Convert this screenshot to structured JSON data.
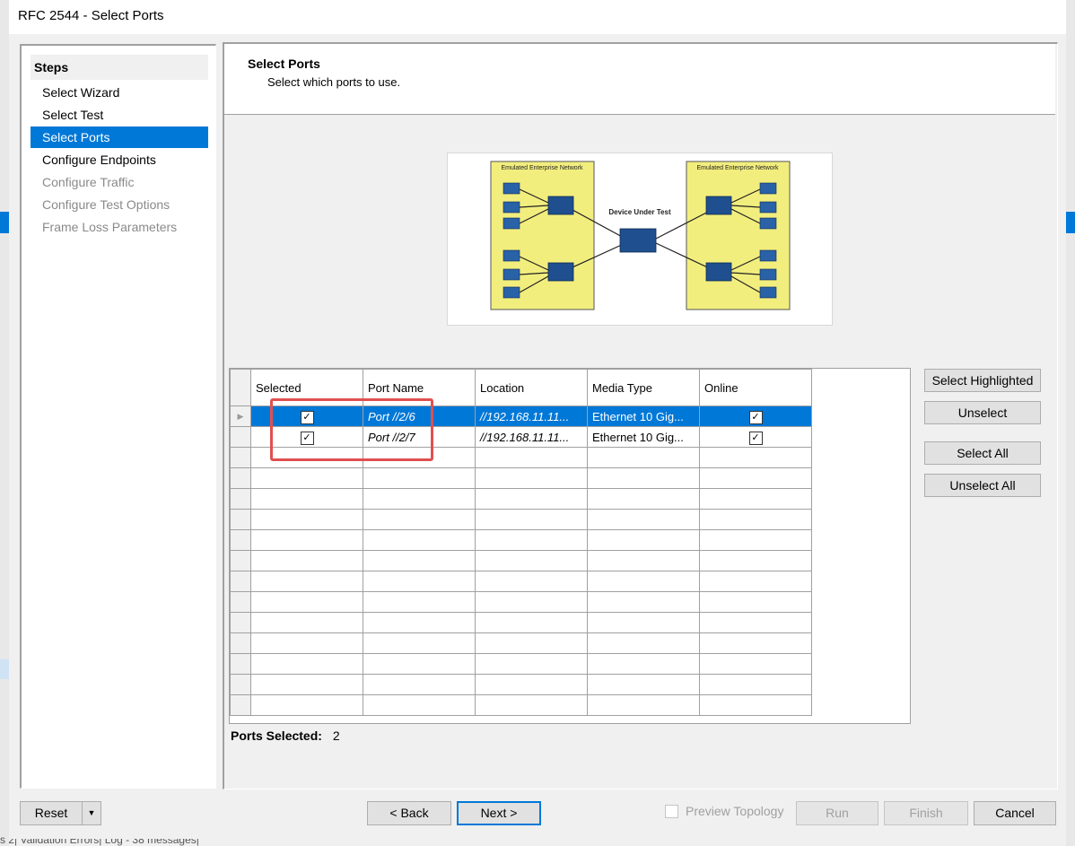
{
  "window": {
    "title": "RFC 2544 - Select Ports"
  },
  "steps": {
    "heading": "Steps",
    "items": [
      {
        "label": "Select Wizard",
        "state": "normal"
      },
      {
        "label": "Select Test",
        "state": "normal"
      },
      {
        "label": "Select Ports",
        "state": "active"
      },
      {
        "label": "Configure Endpoints",
        "state": "normal"
      },
      {
        "label": "Configure Traffic",
        "state": "disabled"
      },
      {
        "label": "Configure Test Options",
        "state": "disabled"
      },
      {
        "label": "Frame Loss Parameters",
        "state": "disabled"
      }
    ]
  },
  "page": {
    "title": "Select Ports",
    "subtitle": "Select which ports to use."
  },
  "diagram": {
    "left_label": "Emulated Enterprise Network",
    "right_label": "Emulated Enterprise Network",
    "center_label": "Device Under Test"
  },
  "grid": {
    "columns": [
      "Selected",
      "Port Name",
      "Location",
      "Media Type",
      "Online"
    ],
    "rows": [
      {
        "selected": true,
        "port_name": "Port //2/6",
        "location": "//192.168.11.11...",
        "media_type": "Ethernet 10 Gig...",
        "online": true,
        "highlighted": true
      },
      {
        "selected": true,
        "port_name": "Port //2/7",
        "location": "//192.168.11.11...",
        "media_type": "Ethernet 10 Gig...",
        "online": true,
        "highlighted": false
      }
    ]
  },
  "side_buttons": {
    "select_highlighted": "Select Highlighted",
    "unselect": "Unselect",
    "select_all": "Select All",
    "unselect_all": "Unselect All"
  },
  "ports_selected": {
    "label": "Ports Selected:",
    "value": "2"
  },
  "footer": {
    "reset": "Reset",
    "back": "< Back",
    "next": "Next >",
    "preview_topology": "Preview Topology",
    "run": "Run",
    "finish": "Finish",
    "cancel": "Cancel"
  },
  "background": {
    "status_text": "s 2| Validation Errors| Log - 38 messages|"
  }
}
